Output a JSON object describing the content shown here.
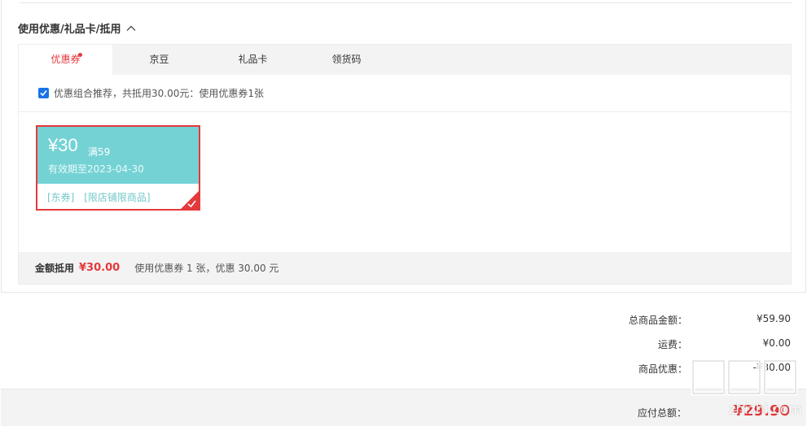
{
  "section": {
    "title": "使用优惠/礼品卡/抵用"
  },
  "tabs": [
    {
      "label": "优惠券",
      "active": true,
      "has_dot": true
    },
    {
      "label": "京豆",
      "active": false
    },
    {
      "label": "礼品卡",
      "active": false
    },
    {
      "label": "领货码",
      "active": false
    }
  ],
  "recommendation": {
    "checked": true,
    "text": "优惠组合推荐，共抵用30.00元：使用优惠券1张"
  },
  "coupon": {
    "amount": "¥30",
    "condition": "满59",
    "validity": "有效期至2023-04-30",
    "tags": [
      "[东券]",
      "[限店铺限商品]"
    ],
    "selected": true
  },
  "deduction": {
    "label": "金额抵用",
    "amount": "¥30.00",
    "detail": "使用优惠券 1 张，优惠 30.00 元"
  },
  "totals": [
    {
      "label": "总商品金额：",
      "value": "¥59.90"
    },
    {
      "label": "运费：",
      "value": "¥0.00"
    },
    {
      "label": "商品优惠：",
      "value": "-¥30.00"
    }
  ],
  "payable": {
    "label": "应付总额：",
    "value": "¥29.90"
  },
  "watermark": {
    "text": "zhizhi.com"
  },
  "colors": {
    "accent": "#e4393c",
    "coupon_bg": "#74d2d4",
    "checkbox": "#1a73e8"
  }
}
